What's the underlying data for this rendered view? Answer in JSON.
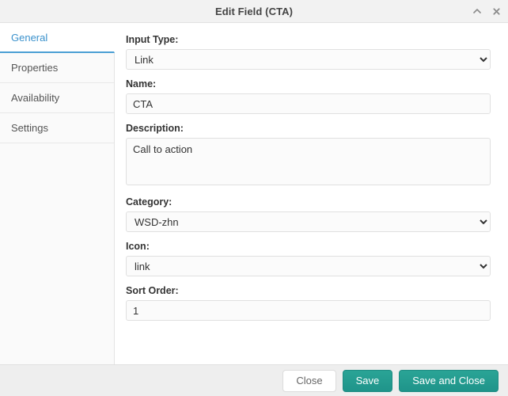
{
  "window": {
    "title": "Edit Field (CTA)",
    "collapse_icon": "chevron-up-icon",
    "close_icon": "close-icon"
  },
  "sidebar": {
    "tabs": [
      {
        "label": "General",
        "active": true
      },
      {
        "label": "Properties",
        "active": false
      },
      {
        "label": "Availability",
        "active": false
      },
      {
        "label": "Settings",
        "active": false
      }
    ]
  },
  "form": {
    "input_type": {
      "label": "Input Type:",
      "value": "Link",
      "options": [
        "Link"
      ]
    },
    "name": {
      "label": "Name:",
      "value": "CTA",
      "placeholder": ""
    },
    "description": {
      "label": "Description:",
      "value": "Call to action",
      "placeholder": ""
    },
    "category": {
      "label": "Category:",
      "value": "WSD-zhn",
      "options": [
        "WSD-zhn"
      ]
    },
    "icon": {
      "label": "Icon:",
      "value": "link",
      "options": [
        "link"
      ]
    },
    "sort_order": {
      "label": "Sort Order:",
      "value": "1",
      "placeholder": ""
    }
  },
  "footer": {
    "close_label": "Close",
    "save_label": "Save",
    "save_and_close_label": "Save and Close"
  },
  "colors": {
    "accent_tab": "#3a91cc",
    "primary_button": "#1f948a",
    "titlebar_bg": "#f2f2f2",
    "footer_bg": "#eeeeee"
  }
}
